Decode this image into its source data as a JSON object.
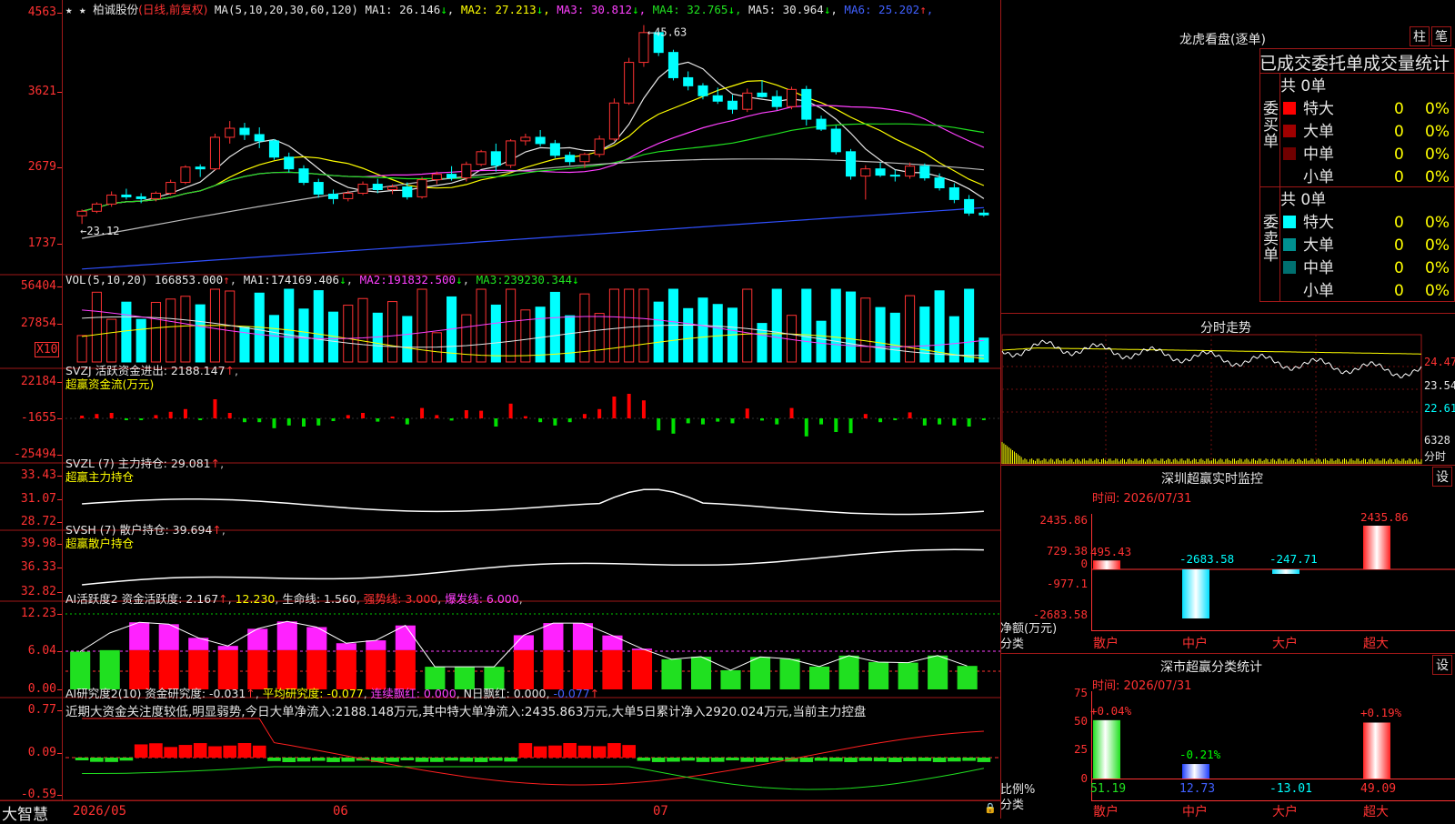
{
  "app": {
    "brand": "大智慧",
    "flag_stars": "★ ★"
  },
  "main_chart": {
    "stock_name": "柏诚股份",
    "period": "(日线,前复权)",
    "ma_label": "MA(5,10,20,30,60,120)",
    "ma": [
      {
        "name": "MA1:",
        "value": "26.146",
        "arrow": "↓",
        "color": "#e6e6e6"
      },
      {
        "name": "MA2:",
        "value": "27.213",
        "arrow": "↓",
        "color": "#ffff00"
      },
      {
        "name": "MA3:",
        "value": "30.812",
        "arrow": "↓",
        "color": "#ff40ff"
      },
      {
        "name": "MA4:",
        "value": "32.765",
        "arrow": "↓",
        "color": "#20e020"
      },
      {
        "name": "MA5:",
        "value": "30.964",
        "arrow": "↓",
        "color": "#e6e6e6"
      },
      {
        "name": "MA6:",
        "value": "25.202",
        "arrow": "↑",
        "color": "#4060ff"
      }
    ],
    "y_labels": [
      "4563",
      "3621",
      "2679",
      "1737"
    ],
    "high_note": "45.63",
    "low_note": "23.12"
  },
  "vol_panel": {
    "label": "VOL(5,10,20)",
    "value": "166853.000",
    "ma1": "174169.406",
    "ma2": "191832.500",
    "ma3": "239230.344",
    "y_labels": [
      "56404",
      "27854"
    ],
    "unit": "X10"
  },
  "svzj_panel": {
    "label": "SVZJ  活跃资金进出:",
    "value": "2188.147",
    "sub": "超赢资金流(万元)",
    "y_labels": [
      "22184",
      "-1655",
      "-25494"
    ]
  },
  "svzl_panel": {
    "label": "SVZL (7) 主力持仓:",
    "value": "29.081",
    "sub": "超赢主力持仓",
    "y_labels": [
      "33.43",
      "31.07",
      "28.72"
    ]
  },
  "svsh_panel": {
    "label": "SVSH (7) 散户持仓:",
    "value": "39.694",
    "sub": "超赢散户持仓",
    "y_labels": [
      "39.98",
      "36.33",
      "32.82"
    ]
  },
  "ai_active_panel": {
    "label": "AI活跃度2 资金活跃度:",
    "value": "2.167",
    "v2": "12.230",
    "life_label": "生命线:",
    "life": "1.560",
    "strong_label": "强势线:",
    "strong": "3.000",
    "burst_label": "爆发线:",
    "burst": "6.000",
    "y_labels": [
      "12.23",
      "6.04",
      "0.00"
    ]
  },
  "ai_research_panel": {
    "label": "AI研究度2(10) 资金研究度:",
    "value": "-0.031",
    "avg_label": "平均研究度:",
    "avg": "-0.077",
    "red_label": "连续飘红:",
    "red": "0.000",
    "nred_label": "N日飘红:",
    "nred": "0.000",
    "last": "-0.077",
    "comment": "近期大资金关注度较低,明显弱势,今日大单净流入:2188.148万元,其中特大单净流入:2435.863万元,大单5日累计净入2920.024万元,当前主力控盘",
    "y_labels": [
      "0.77",
      "0.09",
      "-0.59"
    ]
  },
  "time_axis": [
    "2026/05",
    "06",
    "07"
  ],
  "right_panel": {
    "dragon_title": "龙虎看盘(逐单)",
    "btn_bar": "柱",
    "btn_tick": "笔",
    "order_header": "已成交委托单成交量统计",
    "buy_side": {
      "title": "委买单",
      "total": "共 0单",
      "rows": [
        {
          "label": "特大",
          "qty": "0",
          "pct": "0%",
          "color": "#ff0000"
        },
        {
          "label": "大单",
          "qty": "0",
          "pct": "0%",
          "color": "#a00000"
        },
        {
          "label": "中单",
          "qty": "0",
          "pct": "0%",
          "color": "#700000"
        },
        {
          "label": "小单",
          "qty": "0",
          "pct": "0%",
          "color": "#000000"
        }
      ]
    },
    "sell_side": {
      "title": "委卖单",
      "total": "共 0单",
      "rows": [
        {
          "label": "特大",
          "qty": "0",
          "pct": "0%",
          "color": "#00ffff"
        },
        {
          "label": "大单",
          "qty": "0",
          "pct": "0%",
          "color": "#009090"
        },
        {
          "label": "中单",
          "qty": "0",
          "pct": "0%",
          "color": "#007070"
        },
        {
          "label": "小单",
          "qty": "0",
          "pct": "0%",
          "color": "#000000"
        }
      ]
    },
    "intraday_title": "分时走势",
    "intraday_labels": [
      "24.47",
      "23.54",
      "22.61"
    ],
    "intraday_vol": "6328",
    "intraday_unit": "分时",
    "sz_monitor": {
      "title": "深圳超赢实时监控",
      "btn": "设",
      "time": "时间: 2026/07/31",
      "y_labels": [
        "2435.86",
        "729.38",
        "0",
        "-977.1",
        "-2683.58"
      ],
      "y_unit": "净额(万元)",
      "x_unit": "分类",
      "bars": [
        {
          "name": "散户",
          "value": "495.43"
        },
        {
          "name": "中户",
          "value": "-2683.58"
        },
        {
          "name": "大户",
          "value": "-247.71"
        },
        {
          "name": "超大",
          "value": "2435.86"
        }
      ]
    },
    "sz_class": {
      "title": "深市超赢分类统计",
      "btn": "设",
      "time": "时间: 2026/07/31",
      "y_labels": [
        "75",
        "50",
        "25",
        "0"
      ],
      "y_unit": "比例%",
      "x_unit": "分类",
      "bars": [
        {
          "name": "散户",
          "pct": "+0.04%",
          "value": "51.19"
        },
        {
          "name": "中户",
          "pct": "-0.21%",
          "value": "12.73"
        },
        {
          "name": "大户",
          "pct": "",
          "value": "-13.01"
        },
        {
          "name": "超大",
          "pct": "+0.19%",
          "value": "49.09"
        }
      ]
    }
  },
  "chart_data": {
    "type": "candlestick",
    "price_axis": [
      17.37,
      45.63
    ],
    "candles": [
      [
        24.5,
        25.2,
        23.6,
        25.0
      ],
      [
        25.0,
        26.0,
        24.8,
        25.8
      ],
      [
        25.8,
        27.2,
        25.5,
        26.8
      ],
      [
        26.8,
        27.5,
        26.3,
        26.6
      ],
      [
        26.6,
        27.0,
        25.9,
        26.4
      ],
      [
        26.4,
        27.2,
        26.1,
        27.0
      ],
      [
        27.0,
        28.5,
        26.8,
        28.2
      ],
      [
        28.2,
        30.1,
        28.0,
        29.9
      ],
      [
        29.9,
        30.2,
        28.8,
        29.7
      ],
      [
        29.7,
        33.6,
        29.5,
        33.2
      ],
      [
        33.2,
        35.0,
        32.5,
        34.2
      ],
      [
        34.2,
        34.8,
        32.9,
        33.5
      ],
      [
        33.5,
        34.3,
        32.0,
        32.8
      ],
      [
        32.8,
        33.0,
        30.7,
        31.0
      ],
      [
        31.0,
        31.5,
        29.3,
        29.7
      ],
      [
        29.7,
        30.1,
        27.9,
        28.2
      ],
      [
        28.2,
        28.6,
        26.5,
        26.9
      ],
      [
        26.9,
        27.4,
        25.8,
        26.4
      ],
      [
        26.4,
        27.3,
        26.1,
        27.0
      ],
      [
        27.0,
        28.3,
        26.8,
        28.0
      ],
      [
        28.0,
        28.6,
        27.0,
        27.4
      ],
      [
        27.4,
        28.0,
        26.9,
        27.7
      ],
      [
        27.7,
        28.2,
        26.3,
        26.6
      ],
      [
        26.6,
        28.8,
        26.4,
        28.5
      ],
      [
        28.5,
        29.4,
        28.0,
        29.1
      ],
      [
        29.1,
        30.0,
        28.4,
        28.7
      ],
      [
        28.7,
        30.5,
        28.3,
        30.2
      ],
      [
        30.2,
        31.8,
        30.0,
        31.6
      ],
      [
        31.6,
        32.5,
        29.4,
        30.1
      ],
      [
        30.1,
        33.0,
        29.8,
        32.8
      ],
      [
        32.8,
        33.6,
        32.3,
        33.2
      ],
      [
        33.2,
        34.0,
        32.2,
        32.5
      ],
      [
        32.5,
        32.9,
        30.9,
        31.2
      ],
      [
        31.2,
        31.6,
        30.1,
        30.5
      ],
      [
        30.5,
        31.5,
        29.8,
        31.3
      ],
      [
        31.3,
        33.4,
        31.0,
        33.0
      ],
      [
        33.0,
        37.5,
        32.8,
        37.0
      ],
      [
        37.0,
        42.0,
        36.8,
        41.5
      ],
      [
        41.5,
        45.63,
        41.0,
        44.8
      ],
      [
        44.8,
        45.0,
        42.2,
        42.6
      ],
      [
        42.6,
        42.9,
        39.5,
        39.8
      ],
      [
        39.8,
        40.5,
        38.4,
        38.9
      ],
      [
        38.9,
        39.2,
        37.4,
        37.8
      ],
      [
        37.8,
        38.7,
        36.9,
        37.2
      ],
      [
        37.2,
        37.9,
        35.8,
        36.3
      ],
      [
        36.3,
        38.6,
        36.0,
        38.1
      ],
      [
        38.1,
        39.5,
        37.6,
        37.7
      ],
      [
        37.7,
        38.4,
        36.2,
        36.6
      ],
      [
        36.6,
        38.8,
        36.3,
        38.5
      ],
      [
        38.5,
        38.9,
        34.5,
        35.2
      ],
      [
        35.2,
        35.6,
        33.9,
        34.1
      ],
      [
        34.1,
        34.5,
        31.3,
        31.6
      ],
      [
        31.6,
        31.9,
        28.5,
        28.9
      ],
      [
        28.9,
        30.1,
        26.3,
        29.7
      ],
      [
        29.7,
        30.4,
        28.8,
        29.0
      ],
      [
        29.0,
        29.6,
        28.3,
        28.9
      ],
      [
        28.9,
        30.4,
        28.6,
        30.0
      ],
      [
        30.0,
        30.3,
        28.4,
        28.7
      ],
      [
        28.7,
        29.2,
        27.3,
        27.6
      ],
      [
        27.6,
        28.1,
        25.9,
        26.3
      ],
      [
        26.3,
        26.8,
        24.5,
        24.8
      ],
      [
        24.8,
        25.2,
        24.4,
        24.6
      ]
    ],
    "volume_axis": [
      0,
      56404
    ]
  }
}
